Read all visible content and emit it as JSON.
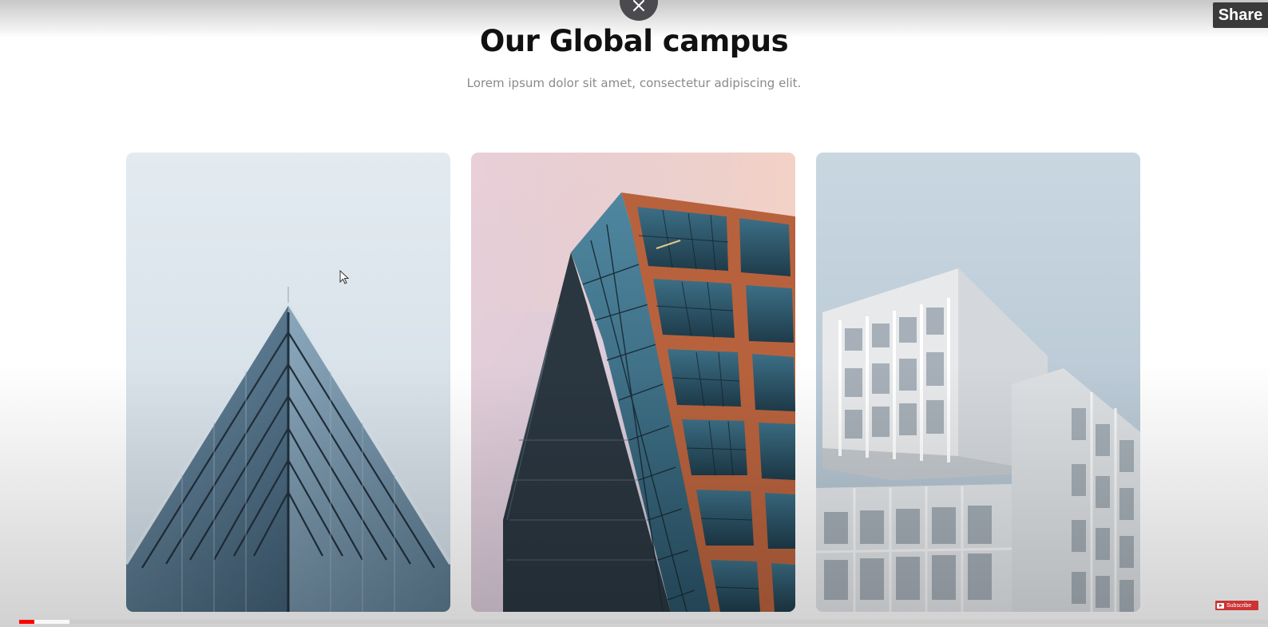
{
  "section": {
    "title": "Our Global campus",
    "subtitle": "Lorem ipsum dolor sit amet, consectetur adipiscing elit."
  },
  "overlay": {
    "share_label": "Share",
    "subscribe_label": "Subscribe",
    "progress_played": 0.012,
    "progress_loaded": 0.04
  },
  "cards": [
    {
      "icon": "triangular-glass-building-image"
    },
    {
      "icon": "copper-frame-tower-image"
    },
    {
      "icon": "white-modular-building-image"
    }
  ],
  "colors": {
    "title": "#111111",
    "subtitle": "#8a8a8a",
    "progress_played": "#ff0000",
    "subscribe": "#cc3333"
  }
}
